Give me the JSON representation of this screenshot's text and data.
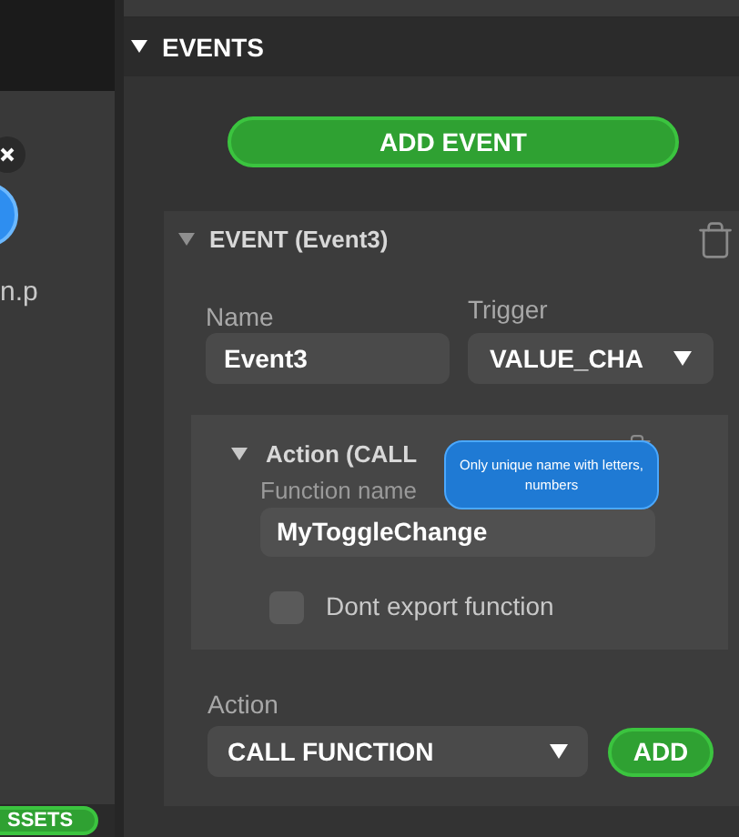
{
  "left_panel": {
    "file_label": "n.p",
    "assets_button": "SSETS"
  },
  "events_section": {
    "title": "EVENTS",
    "expanded": true,
    "add_button": "ADD EVENT",
    "event": {
      "title": "EVENT (Event3)",
      "expanded": true,
      "name_label": "Name",
      "name_value": "Event3",
      "trigger_label": "Trigger",
      "trigger_value": "VALUE_CHA",
      "action": {
        "title": "Action (CALL",
        "expanded": true,
        "function_label": "Function name",
        "function_value": "MyToggleChange",
        "dont_export_label": "Dont export function",
        "dont_export_checked": false,
        "tooltip": "Only unique name with letters, numbers"
      },
      "action_label": "Action",
      "action_value": "CALL FUNCTION",
      "add_button": "ADD"
    }
  }
}
